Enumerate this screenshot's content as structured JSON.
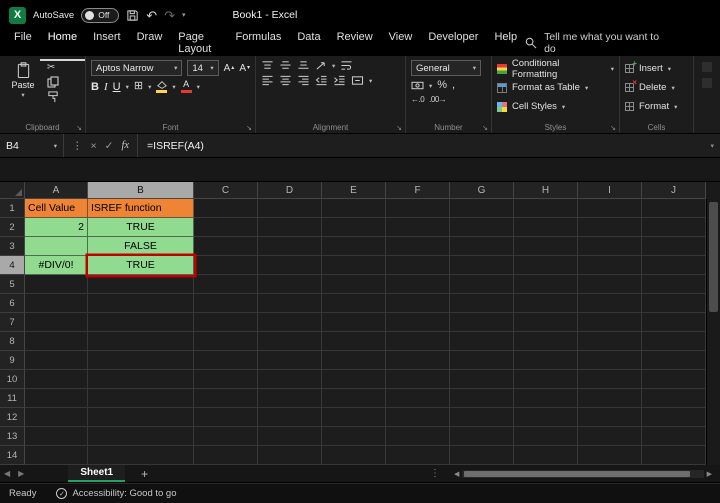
{
  "title_bar": {
    "app_initial": "X",
    "autosave_label": "AutoSave",
    "autosave_state": "Off",
    "workbook_title": "Book1 - Excel"
  },
  "menu_bar": {
    "tabs": [
      "File",
      "Home",
      "Insert",
      "Draw",
      "Page Layout",
      "Formulas",
      "Data",
      "Review",
      "View",
      "Developer",
      "Help"
    ],
    "active_tab": "Home",
    "search_text": "Tell me what you want to do"
  },
  "ribbon": {
    "clipboard": {
      "group_label": "Clipboard",
      "paste_label": "Paste"
    },
    "font": {
      "group_label": "Font",
      "font_name": "Aptos Narrow",
      "font_size": "14",
      "bold": "B",
      "italic": "I",
      "underline": "U"
    },
    "alignment": {
      "group_label": "Alignment"
    },
    "number": {
      "group_label": "Number",
      "format": "General"
    },
    "styles": {
      "group_label": "Styles",
      "conditional_formatting": "Conditional Formatting",
      "format_as_table": "Format as Table",
      "cell_styles": "Cell Styles"
    },
    "cells": {
      "group_label": "Cells",
      "insert": "Insert",
      "delete": "Delete",
      "format": "Format"
    }
  },
  "formula_bar": {
    "name_box": "B4",
    "formula": "=ISREF(A4)",
    "fx_label": "fx"
  },
  "grid": {
    "column_headers": [
      "A",
      "B",
      "C",
      "D",
      "E",
      "F",
      "G",
      "H",
      "I",
      "J"
    ],
    "row_headers": [
      "1",
      "2",
      "3",
      "4",
      "5",
      "6",
      "7",
      "8",
      "9",
      "10",
      "11",
      "12",
      "13",
      "14"
    ],
    "selected_cell": "B4",
    "selected_column": "B",
    "selected_row": "4",
    "cells": [
      {
        "ref": "A1",
        "text": "Cell Value",
        "style": "orange",
        "align": "left"
      },
      {
        "ref": "B1",
        "text": "ISREF function",
        "style": "orange",
        "align": "left"
      },
      {
        "ref": "A2",
        "text": "2",
        "style": "green",
        "align": "right"
      },
      {
        "ref": "B2",
        "text": "TRUE",
        "style": "green",
        "align": "center"
      },
      {
        "ref": "A3",
        "text": "",
        "style": "green",
        "align": "center"
      },
      {
        "ref": "B3",
        "text": "FALSE",
        "style": "green",
        "align": "center"
      },
      {
        "ref": "A4",
        "text": "#DIV/0!",
        "style": "green",
        "align": "center"
      },
      {
        "ref": "B4",
        "text": "TRUE",
        "style": "green annotated",
        "align": "center"
      }
    ],
    "colors": {
      "orange_fill": "#EE8434",
      "green_fill": "#90DB8F",
      "annotation_red": "#C00000"
    }
  },
  "sheet_bar": {
    "tabs": [
      "Sheet1"
    ],
    "active_tab": "Sheet1"
  },
  "status_bar": {
    "mode": "Ready",
    "accessibility": "Accessibility: Good to go"
  },
  "icons": {
    "dropdown": "▾",
    "up": "▴",
    "undo": "↶",
    "redo": "↷",
    "scissors": "✂",
    "letter_a": "A",
    "borders": "⊞",
    "percent": "%",
    "comma": ",",
    "increase_decimal": "←.0",
    "decrease_decimal": ".00→",
    "check": "✓",
    "cancel": "×",
    "vdots": "⋮",
    "launcher": "↘",
    "tab_left": "◀",
    "tab_right": "▶",
    "add": "+"
  }
}
